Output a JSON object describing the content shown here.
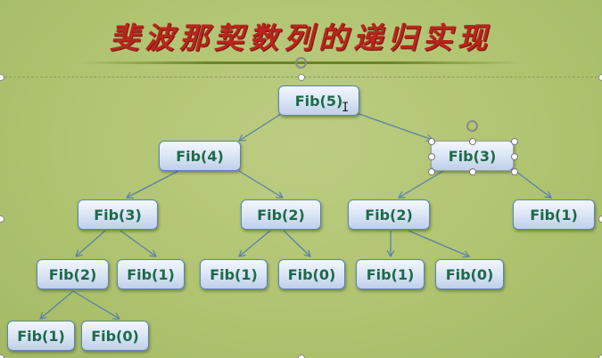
{
  "slide": {
    "title": "斐波那契数列的递归实现"
  },
  "tree": {
    "nodes": [
      {
        "id": "n5",
        "label": "Fib(5)"
      },
      {
        "id": "n4",
        "label": "Fib(4)"
      },
      {
        "id": "n3r",
        "label": "Fib(3)"
      },
      {
        "id": "n3l",
        "label": "Fib(3)"
      },
      {
        "id": "n2a",
        "label": "Fib(2)"
      },
      {
        "id": "n2b",
        "label": "Fib(2)"
      },
      {
        "id": "n1r",
        "label": "Fib(1)"
      },
      {
        "id": "n2c",
        "label": "Fib(2)"
      },
      {
        "id": "n1a",
        "label": "Fib(1)"
      },
      {
        "id": "n1b",
        "label": "Fib(1)"
      },
      {
        "id": "n0a",
        "label": "Fib(0)"
      },
      {
        "id": "n1c",
        "label": "Fib(1)"
      },
      {
        "id": "n0b",
        "label": "Fib(0)"
      },
      {
        "id": "n1d",
        "label": "Fib(1)"
      },
      {
        "id": "n0c",
        "label": "Fib(0)"
      }
    ]
  },
  "colors": {
    "background": "#afc36f",
    "title": "#b8251c",
    "node_text": "#1c6a4a",
    "node_border": "#5d81b5",
    "edge": "#5c7fa8"
  }
}
